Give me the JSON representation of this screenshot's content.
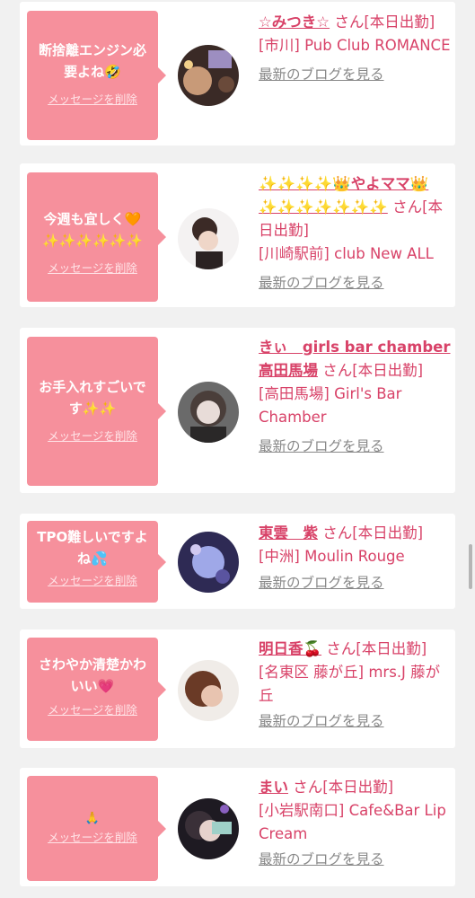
{
  "messages": [
    {
      "comment": "断捨離エンジン必要よね🤣",
      "delete_label": "メッセージを削除",
      "name": "☆みつき☆",
      "san": "さん[本日出勤]",
      "shop": "[市川] Pub Club ROMANCE",
      "blog_label": "最新のブログを見る"
    },
    {
      "comment": "今週も宜しく🧡✨✨✨✨✨✨",
      "delete_label": "メッセージを削除",
      "name": "✨✨✨✨👑やよママ👑✨✨✨✨✨✨✨",
      "san": "さん[本日出勤]",
      "shop": "[川崎駅前] club New ALL",
      "blog_label": "最新のブログを見る"
    },
    {
      "comment": "お手入れすごいです✨✨",
      "delete_label": "メッセージを削除",
      "name": "きぃ　girls bar chamber高田馬場",
      "san": "さん[本日出勤]",
      "shop": "[高田馬場] Girl's Bar Chamber",
      "blog_label": "最新のブログを見る"
    },
    {
      "comment": "TPO難しいですよね💦",
      "delete_label": "メッセージを削除",
      "name": "東雲　紫",
      "san": "さん[本日出勤]",
      "shop": "[中洲] Moulin Rouge",
      "blog_label": "最新のブログを見る"
    },
    {
      "comment": "さわやか清楚かわいい💗",
      "delete_label": "メッセージを削除",
      "name": "明日香🍒",
      "san": "さん[本日出勤]",
      "shop": "[名東区 藤が丘] mrs.J 藤が丘",
      "blog_label": "最新のブログを見る"
    },
    {
      "comment": "🙏",
      "delete_label": "メッセージを削除",
      "name": "まい",
      "san": "さん[本日出勤]",
      "shop": "[小岩駅南口] Cafe&Bar Lip Cream",
      "blog_label": "最新のブログを見る"
    }
  ],
  "colors": {
    "bubble": "#f6909c",
    "accent_text": "#d84268",
    "link_gray": "#888888",
    "page_bg": "#f1f1f1"
  }
}
